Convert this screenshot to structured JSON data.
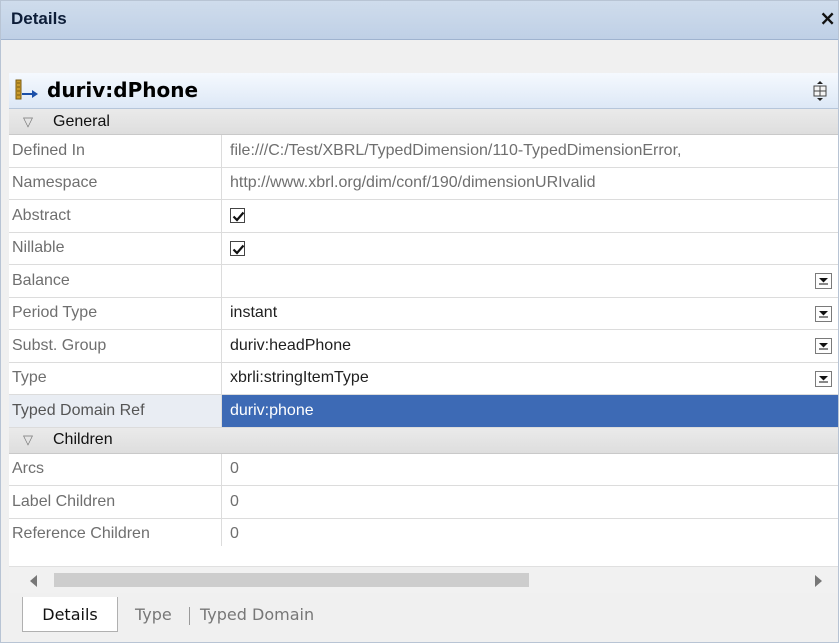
{
  "window": {
    "title": "Details",
    "close_symbol": "×"
  },
  "header": {
    "name": "duriv:dPhone",
    "icon": "dimension-icon",
    "tool_icon": "move-icon"
  },
  "sections": {
    "general": {
      "label": "General",
      "rows": [
        {
          "key": "Defined In",
          "value": "file:///C:/Test/XBRL/TypedDimension/110-TypedDimensionError,"
        },
        {
          "key": "Namespace",
          "value": "http://www.xbrl.org/dim/conf/190/dimensionURIvalid"
        },
        {
          "key": "Abstract",
          "checked": true
        },
        {
          "key": "Nillable",
          "checked": true
        },
        {
          "key": "Balance",
          "value": ""
        },
        {
          "key": "Period Type",
          "value": "instant"
        },
        {
          "key": "Subst. Group",
          "value": "duriv:headPhone"
        },
        {
          "key": "Type",
          "value": "xbrli:stringItemType"
        },
        {
          "key": "Typed Domain Ref",
          "value": "duriv:phone",
          "selected": true
        }
      ]
    },
    "children": {
      "label": "Children",
      "rows": [
        {
          "key": "Arcs",
          "value": "0"
        },
        {
          "key": "Label Children",
          "value": "0"
        },
        {
          "key": "Reference Children",
          "value": "0"
        }
      ]
    }
  },
  "tabs": [
    "Details",
    "Type",
    "Typed Domain"
  ],
  "colors": {
    "selection": "#3d6ab5",
    "titlebar": "#c7d6ea"
  }
}
